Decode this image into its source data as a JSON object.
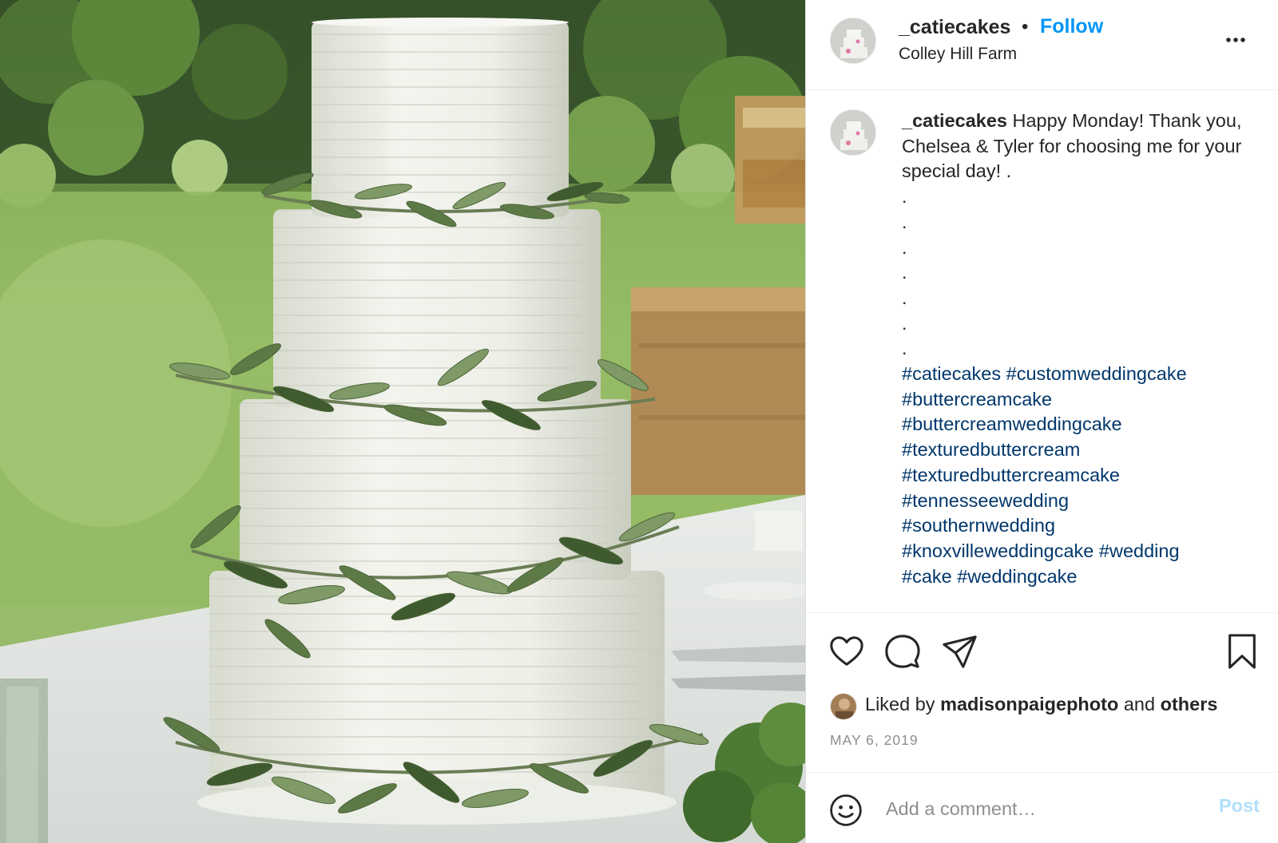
{
  "post": {
    "image_alt": "cake-photo",
    "header": {
      "username": "_catiecakes",
      "separator": "•",
      "follow_label": "Follow",
      "location": "Colley Hill Farm",
      "more_icon": "more-horizontal-icon"
    },
    "caption": {
      "username": "_catiecakes",
      "text": "Happy Monday! Thank you, Chelsea & Tyler for choosing me for your special day! .",
      "dots": [
        ".",
        ".",
        ".",
        ".",
        ".",
        ".",
        "."
      ],
      "hashtags": [
        "#catiecakes",
        "#customweddingcake",
        "#buttercreamcake",
        "#buttercreamweddingcake",
        "#texturedbuttercream",
        "#texturedbuttercreamcake",
        "#tennesseewedding",
        "#southernwedding",
        "#knoxvilleweddingcake",
        "#wedding",
        "#cake",
        "#weddingcake"
      ]
    },
    "actions": {
      "like_icon": "heart-icon",
      "comment_icon": "comment-bubble-icon",
      "share_icon": "paper-plane-icon",
      "save_icon": "bookmark-icon"
    },
    "likes": {
      "prefix": "Liked by",
      "liker": "madisonpaigephoto",
      "conjunction": "and",
      "others": "others"
    },
    "date": "MAY 6, 2019",
    "comment_box": {
      "emoji_icon": "smiley-face-icon",
      "placeholder": "Add a comment…",
      "post_label": "Post"
    }
  },
  "colors": {
    "text": "#262626",
    "link_blue": "#0095f6",
    "hashtag": "#00376b",
    "muted": "#8e8e8e",
    "post_disabled": "#b2dffc",
    "divider": "#efefef"
  }
}
